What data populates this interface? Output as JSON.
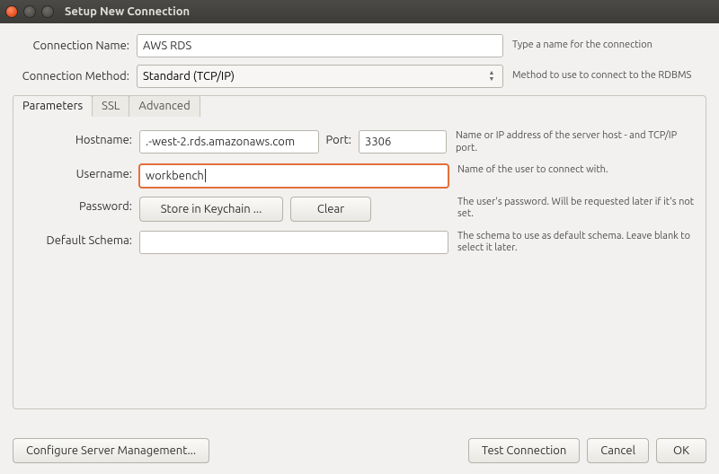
{
  "window": {
    "title": "Setup New Connection"
  },
  "form": {
    "connection_name": {
      "label": "Connection Name:",
      "value": "AWS RDS",
      "help": "Type a name for the connection"
    },
    "connection_method": {
      "label": "Connection Method:",
      "value": "Standard (TCP/IP)",
      "help": "Method to use to connect to the RDBMS"
    }
  },
  "tabs": {
    "parameters": "Parameters",
    "ssl": "SSL",
    "advanced": "Advanced"
  },
  "params": {
    "hostname": {
      "label": "Hostname:",
      "value": ".-west-2.rds.amazonaws.com",
      "help": "Name or IP address of the server host - and TCP/IP port."
    },
    "port": {
      "label": "Port:",
      "value": "3306"
    },
    "username": {
      "label": "Username:",
      "value": "workbench",
      "help": "Name of the user to connect with."
    },
    "password": {
      "label": "Password:",
      "store_btn": "Store in Keychain ...",
      "clear_btn": "Clear",
      "help": "The user's password. Will be requested later if it's not set."
    },
    "default_schema": {
      "label": "Default Schema:",
      "value": "",
      "help": "The schema to use as default schema. Leave blank to select it later."
    }
  },
  "footer": {
    "configure": "Configure Server Management...",
    "test": "Test Connection",
    "cancel": "Cancel",
    "ok": "OK"
  }
}
